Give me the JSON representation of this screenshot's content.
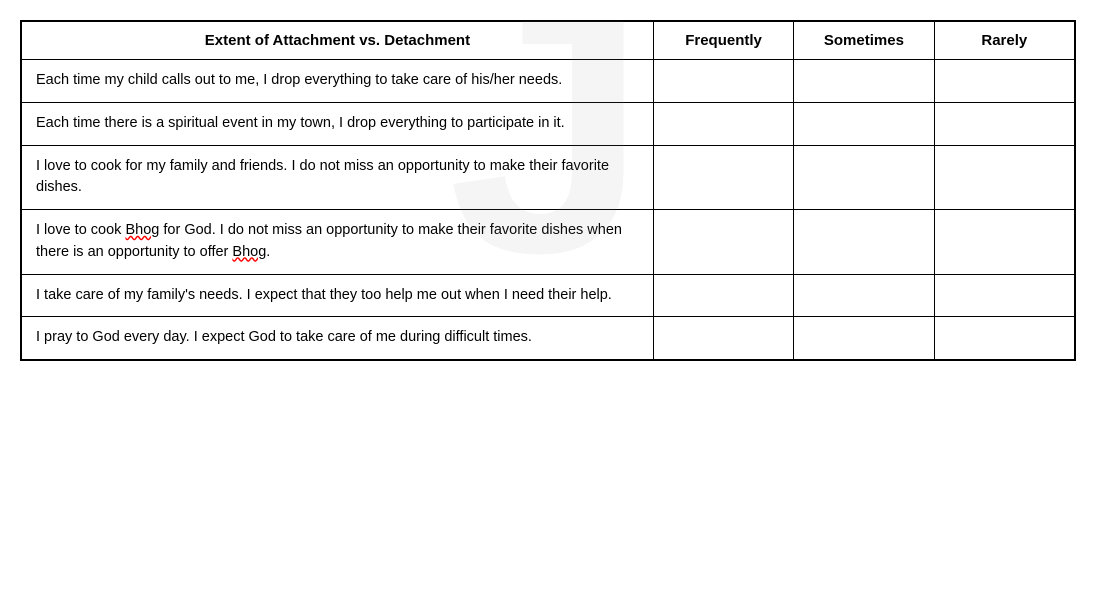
{
  "table": {
    "headers": {
      "question": "Extent of Attachment vs. Detachment",
      "col1": "Frequently",
      "col2": "Sometimes",
      "col3": "Rarely"
    },
    "rows": [
      {
        "id": 1,
        "text": "Each time my child calls out to me, I drop everything to take care of his/her needs.",
        "has_underline": false
      },
      {
        "id": 2,
        "text": "Each time there is a spiritual event in my town, I drop everything to participate in it.",
        "has_underline": false
      },
      {
        "id": 3,
        "text": "I love to cook for my family and friends. I do not miss an opportunity to make their favorite dishes.",
        "has_underline": false
      },
      {
        "id": 4,
        "text_parts": [
          {
            "text": "I love to cook ",
            "underline": false
          },
          {
            "text": "Bhog",
            "underline": true
          },
          {
            "text": " for God. I do not miss an opportunity to make their favorite dishes when there is an opportunity to offer ",
            "underline": false
          },
          {
            "text": "Bhog",
            "underline": true
          },
          {
            "text": ".",
            "underline": false
          }
        ],
        "has_underline": true
      },
      {
        "id": 5,
        "text": "I take care of my family's needs. I expect that they too help me out when I need their help.",
        "has_underline": false
      },
      {
        "id": 6,
        "text": "I pray to God every day. I expect God to take care of me during difficult times.",
        "has_underline": false
      }
    ]
  }
}
